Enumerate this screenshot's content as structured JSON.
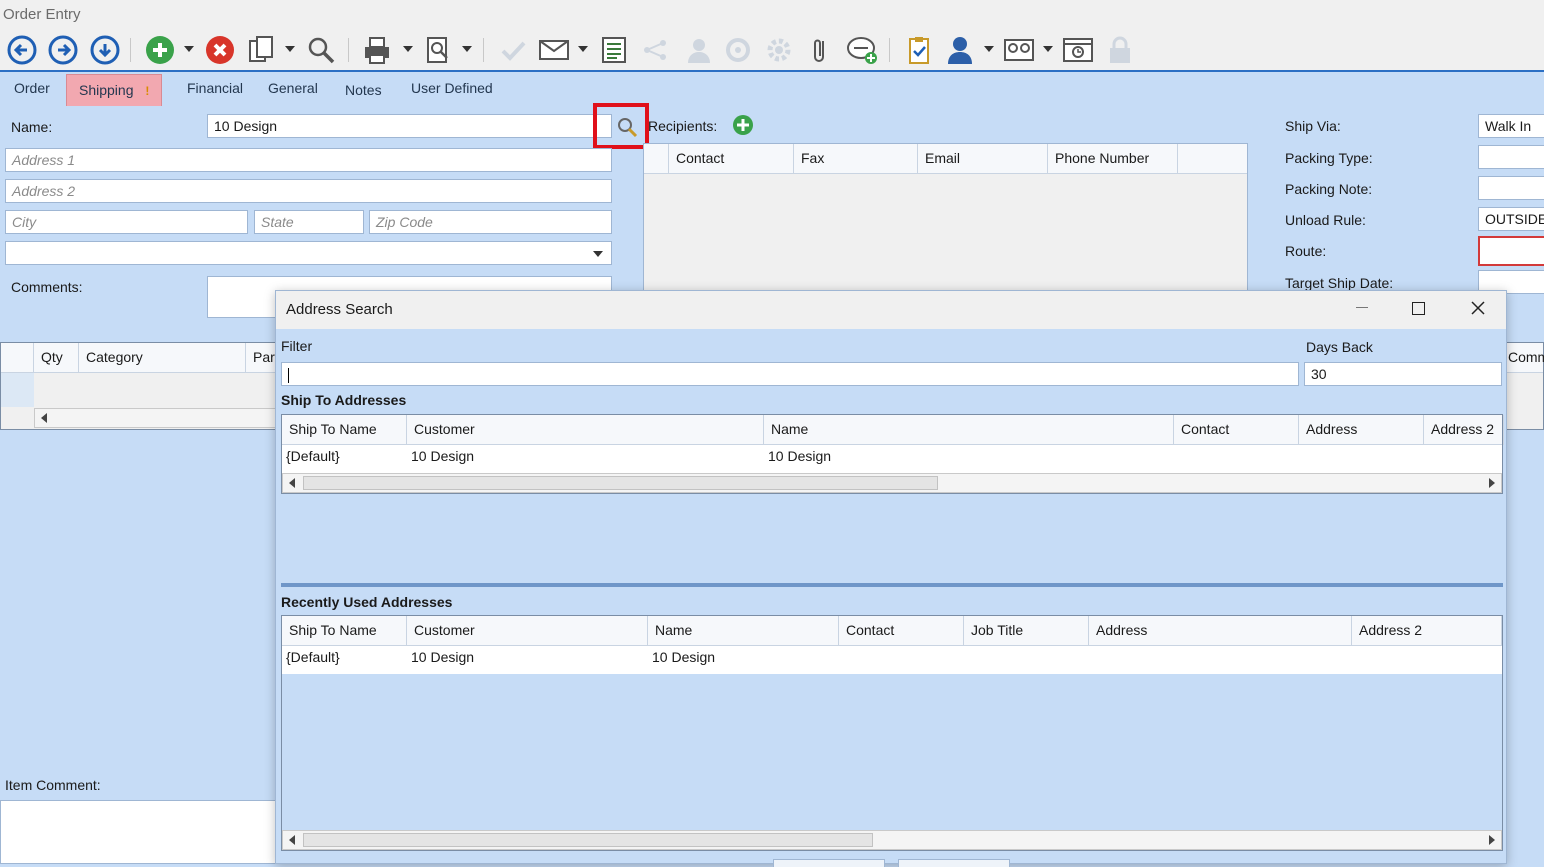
{
  "window": {
    "title": "Order Entry"
  },
  "toolbar": {
    "icons": [
      "back-arrow-icon",
      "forward-arrow-icon",
      "down-arrow-icon",
      "add-icon",
      "cancel-icon",
      "copy-icon",
      "search-icon",
      "print-icon",
      "print-preview-icon",
      "check-icon",
      "email-icon",
      "list-icon",
      "share-icon",
      "user-icon",
      "puzzle-icon",
      "gear-icon",
      "paperclip-icon",
      "comment-add-icon",
      "clipboard-check-icon",
      "person-icon",
      "tape-recorder-icon",
      "calendar-clock-icon",
      "lock-icon"
    ]
  },
  "tabs": [
    {
      "label": "Order"
    },
    {
      "label": "Shipping",
      "badge": "!"
    },
    {
      "label": "Financial"
    },
    {
      "label": "General"
    },
    {
      "label": "Notes"
    },
    {
      "label": "User Defined"
    }
  ],
  "shipping": {
    "name_label": "Name:",
    "name_value": "10 Design",
    "address1_placeholder": "Address 1",
    "address2_placeholder": "Address 2",
    "city_placeholder": "City",
    "state_placeholder": "State",
    "zip_placeholder": "Zip Code",
    "comments_label": "Comments:",
    "recipients_label": "Recipients:",
    "recipients_columns": [
      "Contact",
      "Fax",
      "Email",
      "Phone Number"
    ],
    "ship_via_label": "Ship Via:",
    "ship_via_value": "Walk In",
    "packing_type_label": "Packing Type:",
    "packing_note_label": "Packing Note:",
    "unload_rule_label": "Unload Rule:",
    "unload_rule_value": "OUTSIDE",
    "route_label": "Route:",
    "target_ship_date_label": "Target Ship Date:"
  },
  "items_grid": {
    "columns": [
      "Qty",
      "Category",
      "Part"
    ],
    "right_col": "Comm"
  },
  "item_comment_label": "Item Comment:",
  "dialog": {
    "title": "Address Search",
    "filter_label": "Filter",
    "filter_value": "",
    "days_back_label": "Days Back",
    "days_back_value": "30",
    "ship_to_section": "Ship To Addresses",
    "ship_to_columns": [
      "Ship To Name",
      "Customer",
      "Name",
      "Contact",
      "Address",
      "Address 2"
    ],
    "ship_to_rows": [
      {
        "ship_to_name": "{Default}",
        "customer": "10 Design",
        "name": "10 Design"
      }
    ],
    "recent_section": "Recently Used Addresses",
    "recent_columns": [
      "Ship To Name",
      "Customer",
      "Name",
      "Contact",
      "Job Title",
      "Address",
      "Address 2"
    ],
    "recent_rows": [
      {
        "ship_to_name": "{Default}",
        "customer": "10 Design",
        "name": "10 Design"
      }
    ]
  },
  "colors": {
    "panel_bg": "#c6dcf6",
    "active_tab": "#f2a8b0",
    "highlight_box": "#e0101a",
    "route_border": "#d33a3a"
  }
}
